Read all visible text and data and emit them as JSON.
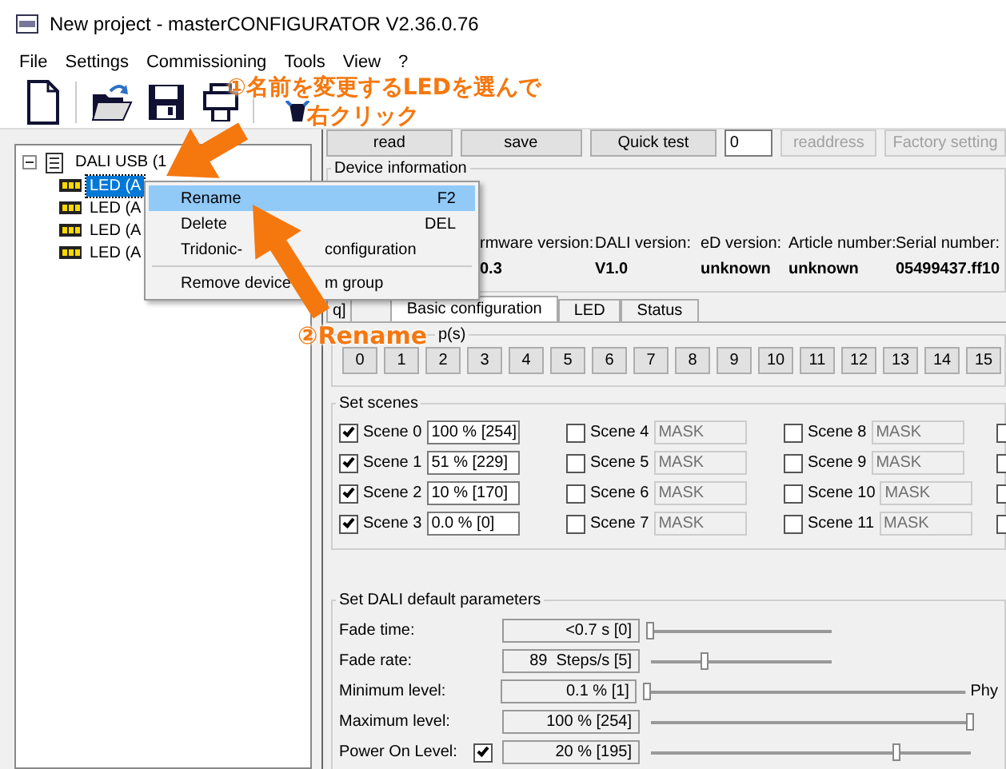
{
  "window": {
    "title": "New project - masterCONFIGURATOR V2.36.0.76"
  },
  "menu": [
    "File",
    "Settings",
    "Commissioning",
    "Tools",
    "View",
    "?"
  ],
  "tree": {
    "label": "DALI USB (1",
    "expanded": true,
    "children": [
      {
        "label": "LED (A",
        "selected": true
      },
      {
        "label": "LED (A",
        "selected": false
      },
      {
        "label": "LED (A",
        "selected": false
      },
      {
        "label": "LED (A",
        "selected": false
      }
    ]
  },
  "actions": [
    {
      "kind": "button",
      "label": "read",
      "disabled": false
    },
    {
      "kind": "button",
      "label": "save",
      "disabled": false
    },
    {
      "kind": "button",
      "label": "Quick test",
      "disabled": false
    },
    {
      "kind": "field",
      "value": "0"
    },
    {
      "kind": "button",
      "label": "readdress",
      "disabled": true
    },
    {
      "kind": "button",
      "label": "Factory setting",
      "disabled": true
    }
  ],
  "device_info": {
    "title": "Device information",
    "fields": [
      {
        "label": "rmware version:",
        "value": "0.3"
      },
      {
        "label": "DALI version:",
        "value": "V1.0"
      },
      {
        "label": "eD version:",
        "value": "unknown"
      },
      {
        "label": "Article number:",
        "value": "unknown"
      },
      {
        "label": "Serial number:",
        "value": "05499437.ff10"
      }
    ]
  },
  "tabs": [
    {
      "label": "q]",
      "selected": false
    },
    {
      "label": "Basic configuration",
      "selected": true
    },
    {
      "label": "LED",
      "selected": false
    },
    {
      "label": "Status",
      "selected": false
    }
  ],
  "groups": {
    "title": "p(s)",
    "buttons": [
      "0",
      "1",
      "2",
      "3",
      "4",
      "5",
      "6",
      "7",
      "8",
      "9",
      "10",
      "11",
      "12",
      "13",
      "14",
      "15"
    ]
  },
  "scenes": {
    "title": "Set scenes",
    "items": [
      {
        "label": "Scene 0",
        "checked": true,
        "value": "100 % [254]"
      },
      {
        "label": "Scene 1",
        "checked": true,
        "value": "51 % [229]"
      },
      {
        "label": "Scene 2",
        "checked": true,
        "value": "10 % [170]"
      },
      {
        "label": "Scene 3",
        "checked": true,
        "value": "0.0 % [0]"
      },
      {
        "label": "Scene 4",
        "checked": false,
        "value": "MASK"
      },
      {
        "label": "Scene 5",
        "checked": false,
        "value": "MASK"
      },
      {
        "label": "Scene 6",
        "checked": false,
        "value": "MASK"
      },
      {
        "label": "Scene 7",
        "checked": false,
        "value": "MASK"
      },
      {
        "label": "Scene 8",
        "checked": false,
        "value": "MASK"
      },
      {
        "label": "Scene 9",
        "checked": false,
        "value": "MASK"
      },
      {
        "label": "Scene 10",
        "checked": false,
        "value": "MASK"
      },
      {
        "label": "Scene 11",
        "checked": false,
        "value": "MASK"
      }
    ],
    "edge_checkboxes": [
      {
        "checked": false
      },
      {
        "checked": false
      },
      {
        "checked": false
      },
      {
        "checked": false
      }
    ]
  },
  "defaults": {
    "title": "Set DALI default parameters",
    "rows": [
      {
        "label": "Fade time:",
        "value": "<0.7 s [0]",
        "kind": "short",
        "level": 0
      },
      {
        "label": "Fade rate:",
        "value": "89  Steps/s [5]",
        "kind": "short",
        "level": 0.3
      },
      {
        "label": "Minimum level:",
        "value": "0.1 % [1]",
        "kind": "long",
        "level": 0,
        "note": "Phy"
      },
      {
        "label": "Maximum level:",
        "value": "100 % [254]",
        "kind": "long",
        "level": 1
      },
      {
        "label": "Power On Level:",
        "value": "20 % [195]",
        "kind": "long",
        "level": 0.77,
        "checked": true
      }
    ]
  },
  "context_menu": {
    "items": [
      {
        "kind": "item",
        "label": "Rename",
        "shortcut": "F2",
        "selected": true
      },
      {
        "kind": "item",
        "label": "Delete",
        "shortcut": "DEL",
        "selected": false
      },
      {
        "kind": "item",
        "label": "Tridonic-",
        "label_2": "configuration",
        "selected": false
      },
      {
        "kind": "separator"
      },
      {
        "kind": "item",
        "label": "Remove device",
        "label_2": "m group",
        "selected": false
      }
    ]
  },
  "annotations": [
    {
      "kind": "callout",
      "text": "①名前を変更するLEDを選んで"
    },
    {
      "kind": "sub",
      "text": "右クリック"
    },
    {
      "kind": "step",
      "text": "②Rename"
    }
  ]
}
